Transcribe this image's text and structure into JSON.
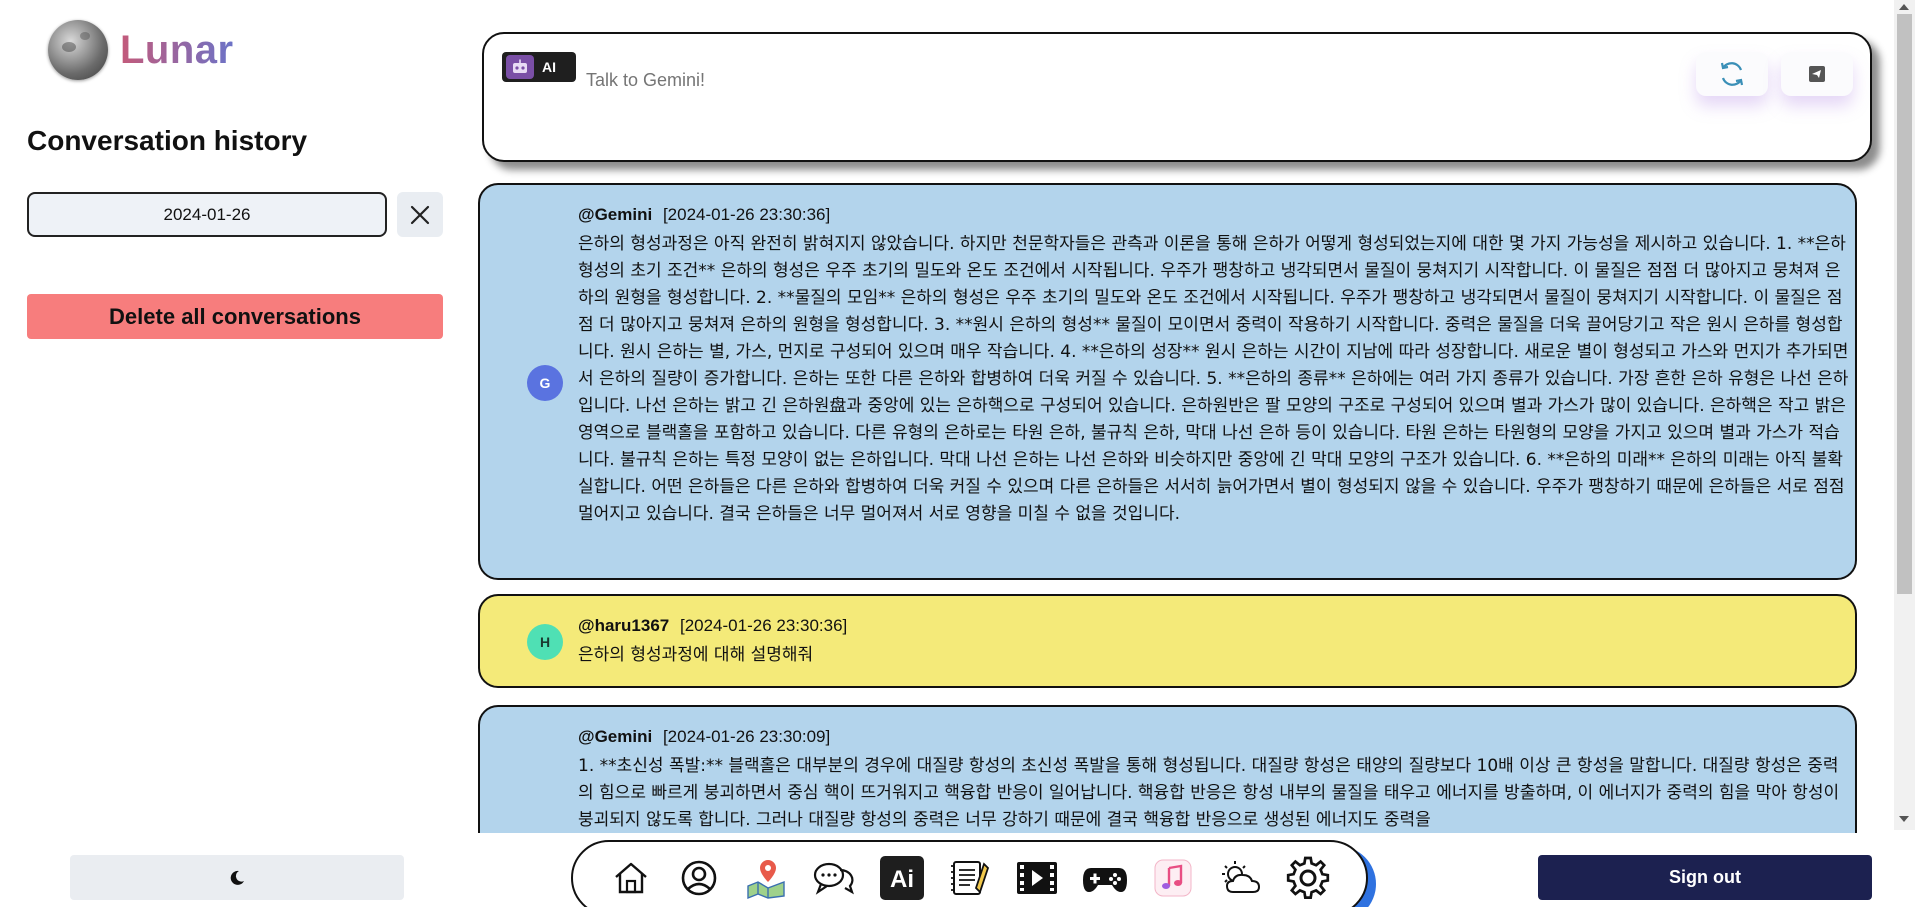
{
  "app": {
    "name": "Lunar"
  },
  "sidebar": {
    "history_title": "Conversation history",
    "date_value": "2024-01-26",
    "clear_icon": "close-icon",
    "delete_all_label": "Delete all conversations"
  },
  "prompt": {
    "badge_label": "AI",
    "placeholder": "Talk to Gemini!",
    "refresh_icon": "refresh-icon",
    "send_icon": "send-icon"
  },
  "messages": [
    {
      "author": "@Gemini",
      "avatar": "G",
      "time": "[2024-01-26 23:30:36]",
      "text": "은하의 형성과정은 아직 완전히 밝혀지지 않았습니다. 하지만 천문학자들은 관측과 이론을 통해 은하가 어떻게 형성되었는지에 대한 몇 가지 가능성을 제시하고 있습니다. 1. **은하 형성의 초기 조건** 은하의 형성은 우주 초기의 밀도와 온도 조건에서 시작됩니다. 우주가 팽창하고 냉각되면서 물질이 뭉쳐지기 시작합니다. 이 물질은 점점 더 많아지고 뭉쳐져 은하의 원형을 형성합니다. 2. **물질의 모임** 은하의 형성은 우주 초기의 밀도와 온도 조건에서 시작됩니다. 우주가 팽창하고 냉각되면서 물질이 뭉쳐지기 시작합니다. 이 물질은 점점 더 많아지고 뭉쳐져 은하의 원형을 형성합니다. 3. **원시 은하의 형성** 물질이 모이면서 중력이 작용하기 시작합니다. 중력은 물질을 더욱 끌어당기고 작은 원시 은하를 형성합니다. 원시 은하는 별, 가스, 먼지로 구성되어 있으며 매우 작습니다. 4. **은하의 성장** 원시 은하는 시간이 지남에 따라 성장합니다. 새로운 별이 형성되고 가스와 먼지가 추가되면서 은하의 질량이 증가합니다. 은하는 또한 다른 은하와 합병하여 더욱 커질 수 있습니다. 5. **은하의 종류** 은하에는 여러 가지 종류가 있습니다. 가장 흔한 은하 유형은 나선 은하입니다. 나선 은하는 밝고 긴 은하원盘과 중앙에 있는 은하핵으로 구성되어 있습니다. 은하원반은 팔 모양의 구조로 구성되어 있으며 별과 가스가 많이 있습니다. 은하핵은 작고 밝은 영역으로 블랙홀을 포함하고 있습니다. 다른 유형의 은하로는 타원 은하, 불규칙 은하, 막대 나선 은하 등이 있습니다. 타원 은하는 타원형의 모양을 가지고 있으며 별과 가스가 적습니다. 불규칙 은하는 특정 모양이 없는 은하입니다. 막대 나선 은하는 나선 은하와 비슷하지만 중앙에 긴 막대 모양의 구조가 있습니다. 6. **은하의 미래** 은하의 미래는 아직 불확실합니다. 어떤 은하들은 다른 은하와 합병하여 더욱 커질 수 있으며 다른 은하들은 서서히 늙어가면서 별이 형성되지 않을 수 있습니다. 우주가 팽창하기 때문에 은하들은 서로 점점 멀어지고 있습니다. 결국 은하들은 너무 멀어져서 서로 영향을 미칠 수 없을 것입니다."
    },
    {
      "author": "@haru1367",
      "avatar": "H",
      "time": "[2024-01-26 23:30:36]",
      "text": "은하의 형성과정에 대해 설명해줘"
    },
    {
      "author": "@Gemini",
      "avatar": "G",
      "time": "[2024-01-26 23:30:09]",
      "text": "1. **초신성 폭발:** 블랙홀은 대부분의 경우에 대질량 항성의 초신성 폭발을 통해 형성됩니다. 대질량 항성은 태양의 질량보다 10배 이상 큰 항성을 말합니다. 대질량 항성은 중력의 힘으로 빠르게 붕괴하면서 중심 핵이 뜨거워지고 핵융합 반응이 일어납니다. 핵융합 반응은 항성 내부의 물질을 태우고 에너지를 방출하며, 이 에너지가 중력의 힘을 막아 항성이 붕괴되지 않도록 합니다. 그러나 대질량 항성의 중력은 너무 강하기 때문에 결국 핵융합 반응으로 생성된 에너지도 중력을"
    }
  ],
  "bottom": {
    "theme_icon": "moon-icon",
    "signout_label": "Sign out",
    "dock": [
      {
        "name": "home-icon"
      },
      {
        "name": "profile-icon"
      },
      {
        "name": "map-icon"
      },
      {
        "name": "chat-icon"
      },
      {
        "name": "ai-icon",
        "label": "Ai"
      },
      {
        "name": "notes-icon"
      },
      {
        "name": "video-icon"
      },
      {
        "name": "game-icon"
      },
      {
        "name": "music-icon"
      },
      {
        "name": "weather-icon"
      },
      {
        "name": "settings-icon"
      }
    ]
  },
  "colors": {
    "gemini_bubble": "#b3d4ec",
    "user_bubble": "#f4ea79",
    "delete_button": "#f77d7d",
    "signout_button": "#1c2150",
    "dock_shadow": "#2f72e0"
  }
}
